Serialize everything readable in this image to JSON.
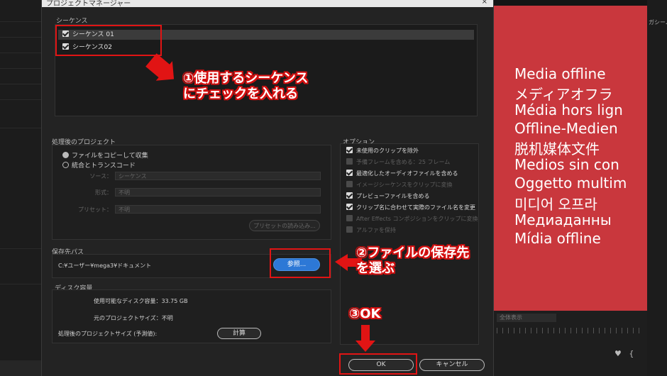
{
  "dialog": {
    "title": "プロジェクトマネージャー",
    "close": "×"
  },
  "sequences": {
    "label": "シーケンス",
    "items": [
      {
        "label": "シーケンス 01",
        "checked": true
      },
      {
        "label": "シーケンス02",
        "checked": true
      }
    ]
  },
  "resulting_project": {
    "label": "処理後のプロジェクト",
    "copy_option": "ファイルをコピーして収集",
    "consolidate_option": "統合とトランスコード",
    "source_label": "ソース：",
    "source_value": "シーケンス",
    "format_label": "形式：",
    "format_value": "不明",
    "preset_label": "プリセット：",
    "preset_value": "不明",
    "import_preset_button": "プリセットの読み込み..."
  },
  "options": {
    "label": "オプション",
    "items": [
      {
        "label": "未使用のクリップを除外",
        "checked": true,
        "enabled": true
      },
      {
        "label": "予備フレームを含める：25 フレーム",
        "checked": false,
        "enabled": false
      },
      {
        "label": "最適化したオーディオファイルを含める",
        "checked": true,
        "enabled": true
      },
      {
        "label": "イメージシーケンスをクリップに変換",
        "checked": false,
        "enabled": false
      },
      {
        "label": "プレビューファイルを含める",
        "checked": true,
        "enabled": true
      },
      {
        "label": "クリップ名に合わせて実際のファイル名を変更",
        "checked": true,
        "enabled": true
      },
      {
        "label": "After Effects コンポジションをクリップに変換",
        "checked": false,
        "enabled": false
      },
      {
        "label": "アルファを保持",
        "checked": false,
        "enabled": false
      }
    ]
  },
  "destination": {
    "label": "保存先パス",
    "path": "C:¥ユーザー¥mega3¥ドキュメント",
    "browse_button": "参照..."
  },
  "disk": {
    "label": "ディスク容量",
    "available": "使用可能なディスク容量：33.75 GB",
    "original": "元のプロジェクトサイズ：不明",
    "resulting": "処理後のプロジェクトサイズ (予測値):",
    "calculate_button": "計算"
  },
  "footer": {
    "ok_button": "OK",
    "cancel_button": "キャンセル"
  },
  "annotations": {
    "step1_line1": "①使用するシーケンス",
    "step1_line2": "にチェックを入れる",
    "step2_line1": "②ファイルの保存先",
    "step2_line2": "を選ぶ",
    "step3": "③OK"
  },
  "monitor": {
    "offline_texts": [
      "Media offline",
      "メディアオフラ",
      "Média hors lign",
      "Offline-Medien",
      "脱机媒体文件",
      "Medios sin con",
      "Oggetto multim",
      "미디어 오프라",
      "Медиаданны",
      "Mídia offline"
    ],
    "zoom_label": "全体表示",
    "bg_right_label": "ガシーム"
  },
  "colors": {
    "accent_blue": "#2d78d6",
    "annotation_red": "#e11414",
    "offline_red": "#c9373d"
  }
}
